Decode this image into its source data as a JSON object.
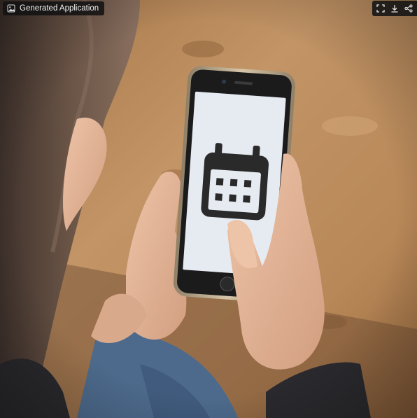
{
  "app": {
    "title": "Generated Application"
  },
  "toolbar": {
    "buttons": [
      {
        "icon": "fullscreen-icon"
      },
      {
        "icon": "download-icon"
      },
      {
        "icon": "share-icon"
      }
    ]
  },
  "photo": {
    "screen_icon": "calendar-icon",
    "colors": {
      "table_wood": "#b98a58",
      "phone_frame": "#c9b79b",
      "phone_screen": "#e6ebf1",
      "calendar_glyph": "#2a2a2a",
      "skin": "#e3b59a",
      "hair": "#5e4a3e",
      "sleeve": "#2a2a2e",
      "jeans": "#4d6a8c"
    }
  }
}
